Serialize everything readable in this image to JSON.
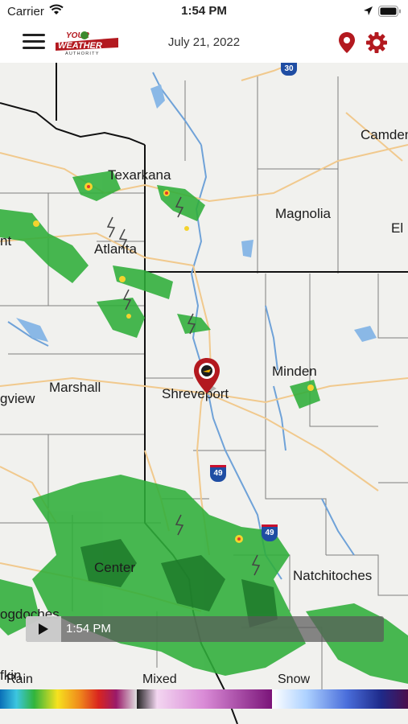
{
  "status_bar": {
    "carrier": "Carrier",
    "time": "1:54 PM"
  },
  "header": {
    "date": "July 21, 2022",
    "logo": "YOUR WEATHER AUTHORITY"
  },
  "map": {
    "cities": [
      "Camden",
      "Texarkana",
      "Magnolia",
      "El",
      "nt",
      "Atlanta",
      "Minden",
      "Marshall",
      "Shreveport",
      "gview",
      "Center",
      "Natchitoches",
      "ogdoches",
      "fkin"
    ],
    "highways": [
      "30",
      "49",
      "49"
    ]
  },
  "playback": {
    "time": "1:54 PM"
  },
  "legend": {
    "rain": "Rain",
    "mixed": "Mixed",
    "snow": "Snow"
  }
}
